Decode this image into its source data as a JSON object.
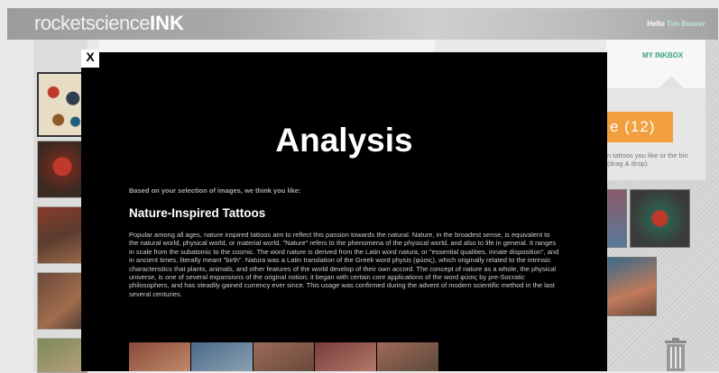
{
  "header": {
    "logo_light": "rocketscience",
    "logo_bold": "INK",
    "greeting": "Hello",
    "user_name": "Tim Beaver"
  },
  "right_panel": {
    "tab_label": "MY INKBOX",
    "count_label": "e (12)",
    "instructions": "n tattoos you like or the bin (drag & drop)."
  },
  "modal": {
    "close_label": "X",
    "title": "Analysis",
    "intro": "Based on your selection of images, we think you like:",
    "heading": "Nature-Inspired Tattoos",
    "body": "Popular among all ages, nature inspired tattoos aim to reflect this passion towards the natural. Nature, in the broadest sense, is equivalent to the natural world, physical world, or material world. \"Nature\" refers to the phenomena of the physical world, and also to life in general. It ranges in scale from the subatomic to the cosmic. The word nature is derived from the Latin word natura, or \"essential qualities, innate disposition\", and in ancient times, literally meant \"birth\". Natura was a Latin translation of the Greek word physis (φύσις), which originally related to the intrinsic characteristics that plants, animals, and other features of the world develop of their own accord. The concept of nature as a whole, the physical universe, is one of several expansions of the original notion; it began with certain core applications of the word φύσις by pre-Socratic philosophers, and has steadily gained currency ever since. This usage was confirmed during the advent of modern scientific method in the last several centuries."
  },
  "colors": {
    "accent_orange": "#f2a03f",
    "accent_green": "#3aa57a",
    "modal_bg": "#000000"
  }
}
